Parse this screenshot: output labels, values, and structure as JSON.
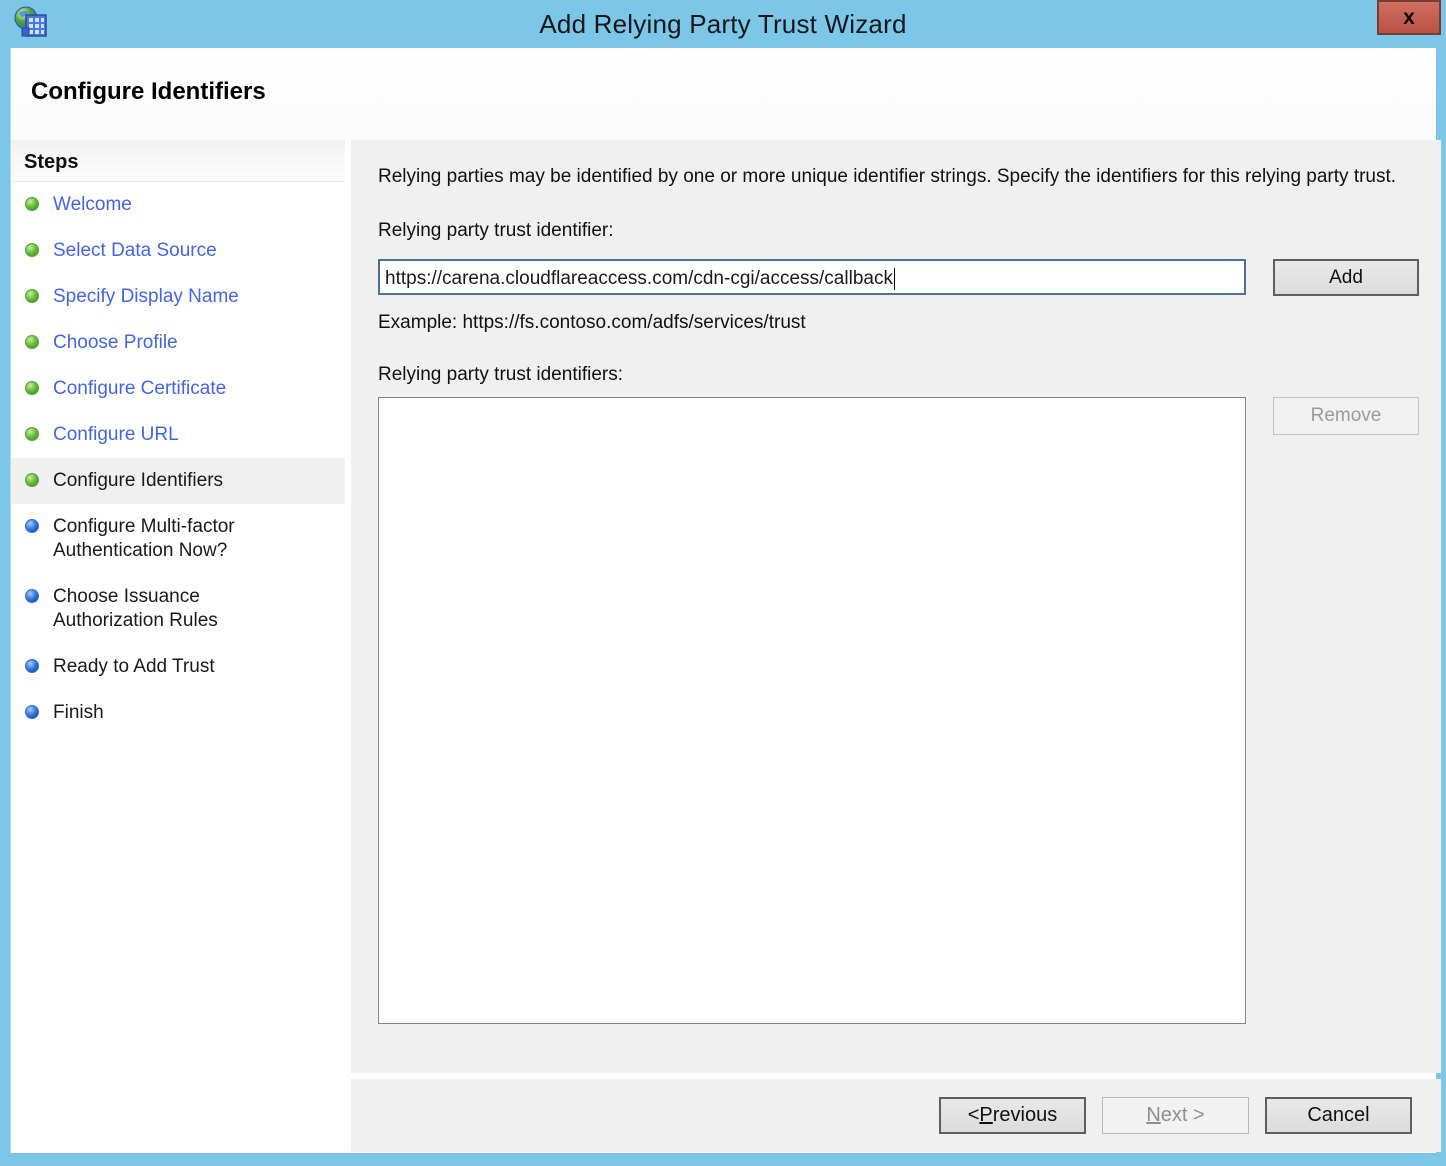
{
  "window": {
    "title": "Add Relying Party Trust Wizard",
    "close_label": "x",
    "heading": "Configure Identifiers"
  },
  "sidebar": {
    "title": "Steps",
    "items": [
      {
        "label": "Welcome",
        "state": "done"
      },
      {
        "label": "Select Data Source",
        "state": "done"
      },
      {
        "label": "Specify Display Name",
        "state": "done"
      },
      {
        "label": "Choose Profile",
        "state": "done"
      },
      {
        "label": "Configure Certificate",
        "state": "done"
      },
      {
        "label": "Configure URL",
        "state": "done"
      },
      {
        "label": "Configure Identifiers",
        "state": "current"
      },
      {
        "label": "Configure Multi-factor Authentication Now?",
        "state": "pending"
      },
      {
        "label": "Choose Issuance Authorization Rules",
        "state": "pending"
      },
      {
        "label": "Ready to Add Trust",
        "state": "pending"
      },
      {
        "label": "Finish",
        "state": "pending"
      }
    ]
  },
  "main": {
    "intro": "Relying parties may be identified by one or more unique identifier strings. Specify the identifiers for this relying party trust.",
    "identifier_label": "Relying party trust identifier:",
    "identifier_value": "https://carena.cloudflareaccess.com/cdn-cgi/access/callback",
    "add_label": "Add",
    "example": "Example: https://fs.contoso.com/adfs/services/trust",
    "identifiers_label": "Relying party trust identifiers:",
    "identifiers_list": [],
    "remove_label": "Remove"
  },
  "footer": {
    "previous": {
      "label": "< Previous",
      "mnemonic": "P"
    },
    "next": {
      "label": "Next >",
      "mnemonic": "N"
    },
    "cancel": {
      "label": "Cancel"
    }
  },
  "colors": {
    "titlebar": "#7cc6e8",
    "close_button": "#c25b50",
    "link": "#4565dc",
    "step_done": "#54b232",
    "step_pending": "#3572d6",
    "panel_gray": "#f0f0f0",
    "input_focus_border": "#4d7294"
  }
}
